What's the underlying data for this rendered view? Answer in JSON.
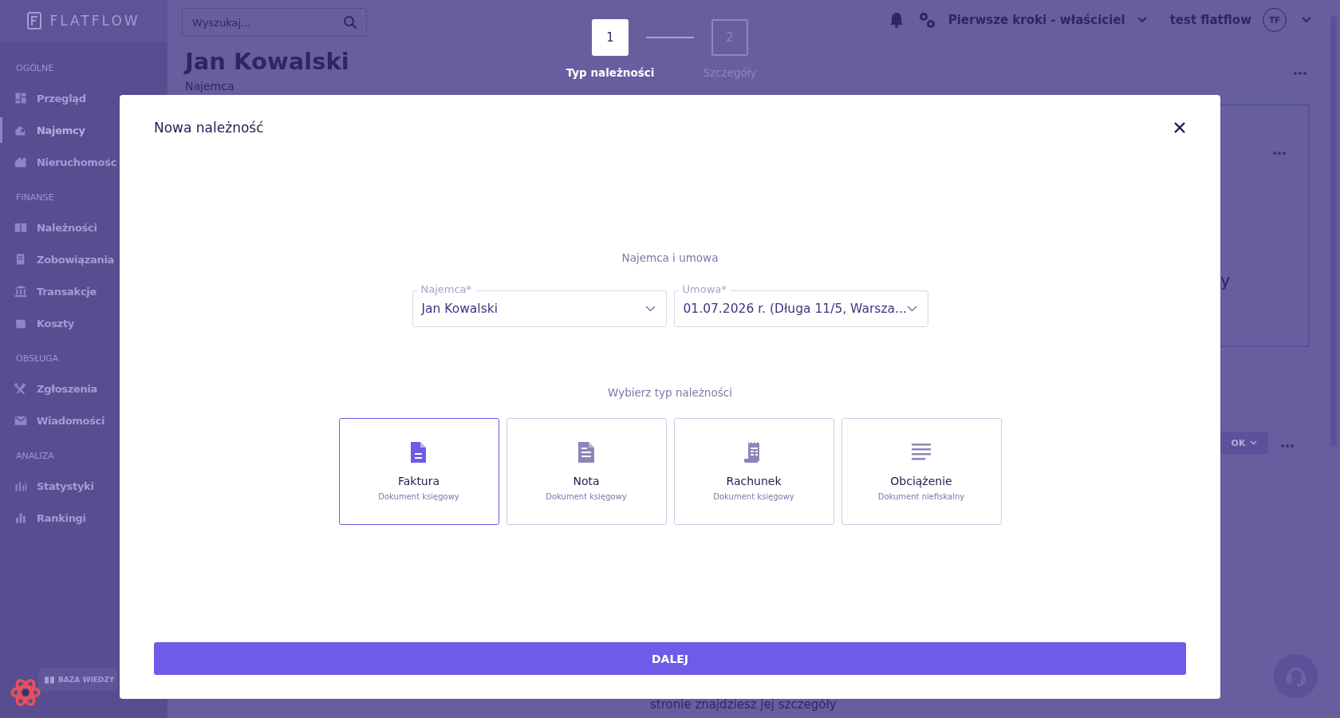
{
  "sidebar": {
    "logo": "FLATFLOW",
    "sections": [
      {
        "title": "OGÓLNE",
        "items": [
          {
            "label": "Przegląd",
            "selected": false
          },
          {
            "label": "Najemcy",
            "selected": true
          },
          {
            "label": "Nieruchomośc",
            "selected": false
          }
        ]
      },
      {
        "title": "FINANSE",
        "items": [
          {
            "label": "Należności",
            "selected": false
          },
          {
            "label": "Zobowiązania",
            "selected": false
          },
          {
            "label": "Transakcje",
            "selected": false
          },
          {
            "label": "Koszty",
            "selected": false
          }
        ]
      },
      {
        "title": "OBSŁUGA",
        "items": [
          {
            "label": "Zgłoszenia",
            "selected": false
          },
          {
            "label": "Wiadomości",
            "selected": false
          }
        ]
      },
      {
        "title": "ANALIZA",
        "items": [
          {
            "label": "Statystyki",
            "selected": false
          },
          {
            "label": "Rankingi",
            "selected": false
          }
        ]
      }
    ],
    "knowledge_button": "BAZA WIEDZY"
  },
  "header": {
    "search": {
      "placeholder": "Wyszukaj..."
    },
    "workspace": "Pierwsze kroki - właściciel",
    "user": "test flatflow",
    "avatar": "TF"
  },
  "page": {
    "title": "Jan Kowalski",
    "subtitle": "Najemca",
    "cut_text": "y",
    "button": "OK",
    "footer_text": "stronie znajdziesz jej szczegóły"
  },
  "stepper": [
    {
      "number": "1",
      "label": "Typ należności",
      "selected": true
    },
    {
      "number": "2",
      "label": "Szczegóły",
      "selected": false
    }
  ],
  "modal": {
    "title": "Nowa należność",
    "section_label": "Najemca i umowa",
    "fields": [
      {
        "label": "Najemca*",
        "value": "Jan Kowalski"
      },
      {
        "label": "Umowa*",
        "value": "01.07.2026 r. (Długa 11/5, Warsza..."
      }
    ],
    "type_label": "Wybierz typ należności",
    "types": [
      {
        "kind": "file",
        "title": "Faktura",
        "subtitle": "Dokument księgowy",
        "selected": true
      },
      {
        "kind": "note",
        "title": "Nota",
        "subtitle": "Dokument księgowy",
        "selected": false
      },
      {
        "kind": "receipt",
        "title": "Rachunek",
        "subtitle": "Dokument księgowy",
        "selected": false
      },
      {
        "kind": "lines",
        "title": "Obciążenie",
        "subtitle": "Dokument niefiskalny",
        "selected": false
      }
    ],
    "submit": "DALEJ"
  }
}
